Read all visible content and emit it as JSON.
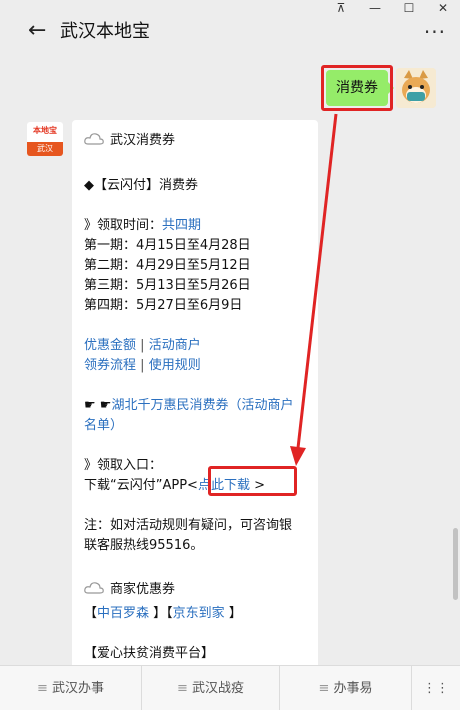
{
  "window": {
    "ctrl_pin": "⊼",
    "ctrl_min": "—",
    "ctrl_max": "☐",
    "ctrl_close": "✕"
  },
  "header": {
    "back_icon": "←",
    "title": "武汉本地宝",
    "more_icon": "···"
  },
  "sent_message": {
    "text": "消费券"
  },
  "bot": {
    "avatar_top": "本地宝",
    "avatar_bottom": "武汉"
  },
  "article": {
    "heading": "武汉消费券",
    "section_title": "◆【云闪付】消费券",
    "period_label": "》领取时间：",
    "period_link": "共四期",
    "phases": [
      "第一期：4月15日至4月28日",
      "第二期：4月29日至5月12日",
      "第三期：5月13日至5月26日",
      "第四期：5月27日至6月9日"
    ],
    "links_row1": [
      "优惠金额",
      "活动商户"
    ],
    "links_row2": [
      "领券流程",
      "使用规则"
    ],
    "separator": "|",
    "merchants_prefix": "☛ ☛",
    "merchants_link_1": "湖北千万惠民消费券（活动商户",
    "merchants_link_2": "名单）",
    "entry_label": "》领取入口：",
    "download_text": "下载“云闪付”APP<",
    "download_link": "点此下载",
    "download_suffix": " >",
    "note_1": "注：如对活动规则有疑问，可咨询银",
    "note_2": "联客服热线95516。",
    "merchant_coupon": "商家优惠券",
    "coupon_open_1": "【",
    "coupon_link_1": "中百罗森",
    "coupon_close_open": " 】【",
    "coupon_link_2": "京东到家",
    "coupon_close_2": " 】",
    "poverty": "【爱心扶贫消费平台】"
  },
  "bottom_nav": [
    {
      "label": "武汉办事"
    },
    {
      "label": "武汉战疫"
    },
    {
      "label": "办事易"
    },
    {
      "label": "⋮⋮"
    }
  ],
  "colors": {
    "accent_link": "#2a6fbf",
    "sent_bubble": "#95ec69",
    "annotation": "#e02424"
  }
}
